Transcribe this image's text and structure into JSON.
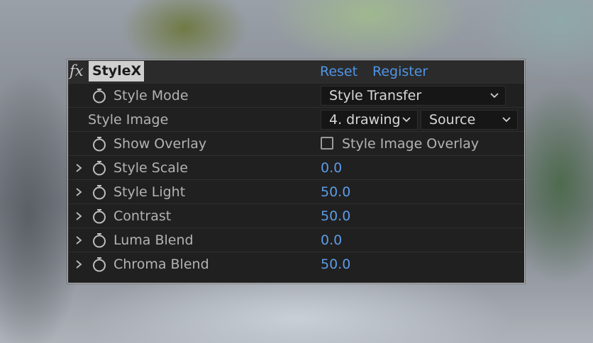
{
  "effect": {
    "fx_label": "fx",
    "name": "StyleX",
    "reset_label": "Reset",
    "register_label": "Register"
  },
  "rows": [
    {
      "label": "Style Mode",
      "control": "dropdown",
      "value": "Style Transfer"
    },
    {
      "label": "Style Image",
      "control": "dual-dropdown",
      "value": "4. drawing",
      "value2": "Source"
    },
    {
      "label": "Show Overlay",
      "control": "checkbox",
      "checked": false,
      "value": "Style Image Overlay"
    },
    {
      "label": "Style Scale",
      "control": "number",
      "value": "0.0"
    },
    {
      "label": "Style Light",
      "control": "number",
      "value": "50.0"
    },
    {
      "label": "Contrast",
      "control": "number",
      "value": "50.0"
    },
    {
      "label": "Luma Blend",
      "control": "number",
      "value": "0.0"
    },
    {
      "label": "Chroma Blend",
      "control": "number",
      "value": "50.0"
    }
  ],
  "icons": {
    "fx": "fx-icon",
    "stopwatch": "stopwatch-icon",
    "expand": "chevron-right-icon",
    "dropdown": "chevron-down-icon"
  },
  "colors": {
    "panel_bg": "#202020",
    "header_bg": "#2b2b2b",
    "title_bg": "#cfcfcf",
    "link": "#4f95e6",
    "value": "#5d9be6",
    "label": "#b3b3b3"
  }
}
